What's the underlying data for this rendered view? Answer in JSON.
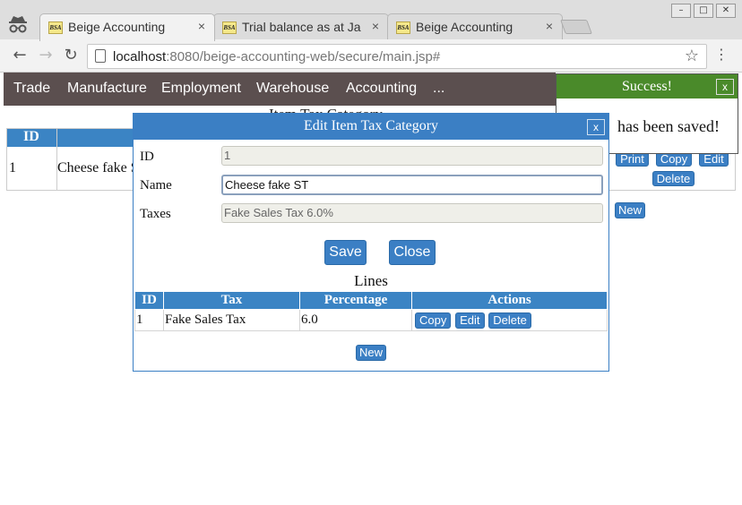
{
  "browser": {
    "tabs": [
      {
        "favicon": "BSA",
        "title": "Beige Accounting",
        "close": "×"
      },
      {
        "favicon": "BSA",
        "title": "Trial balance as at Jan",
        "close": "×"
      },
      {
        "favicon": "BSA",
        "title": "Beige Accounting",
        "close": "×"
      }
    ],
    "window_buttons": {
      "minimize": "–",
      "maximize": "□",
      "close": "✕"
    },
    "nav": {
      "back": "←",
      "forward": "→",
      "reload": "↻",
      "menu": "⋮"
    },
    "url_host": "localhost",
    "url_path": ":8080/beige-accounting-web/secure/main.jsp#",
    "star": "☆"
  },
  "app": {
    "nav_items": [
      "Trade",
      "Manufacture",
      "Employment",
      "Warehouse",
      "Accounting",
      "..."
    ],
    "background_heading": "Item Tax Category",
    "background_table": {
      "header_id": "ID",
      "row": {
        "id": "1",
        "name": "Cheese fake ST"
      },
      "buttons": {
        "print": "Print",
        "copy": "Copy",
        "edit": "Edit",
        "delete": "Delete"
      },
      "new": "New"
    },
    "toast": {
      "title": "Success!",
      "close": "x",
      "message": "has been saved!"
    },
    "dialog": {
      "title": "Edit Item Tax Category",
      "close": "x",
      "fields": {
        "id_label": "ID",
        "id_value": "1",
        "name_label": "Name",
        "name_value": "Cheese fake ST",
        "taxes_label": "Taxes",
        "taxes_value": "Fake Sales Tax 6.0%"
      },
      "save": "Save",
      "close_btn": "Close",
      "lines_title": "Lines",
      "lines_columns": [
        "ID",
        "Tax",
        "Percentage",
        "Actions"
      ],
      "lines_rows": [
        {
          "id": "1",
          "tax": "Fake Sales Tax",
          "percentage": "6.0"
        }
      ],
      "row_actions": {
        "copy": "Copy",
        "edit": "Edit",
        "delete": "Delete"
      },
      "new": "New"
    }
  },
  "colors": {
    "accent_blue": "#3b7fc4",
    "nav_bg": "#5b4f4f",
    "success_green": "#4a8a2a"
  }
}
